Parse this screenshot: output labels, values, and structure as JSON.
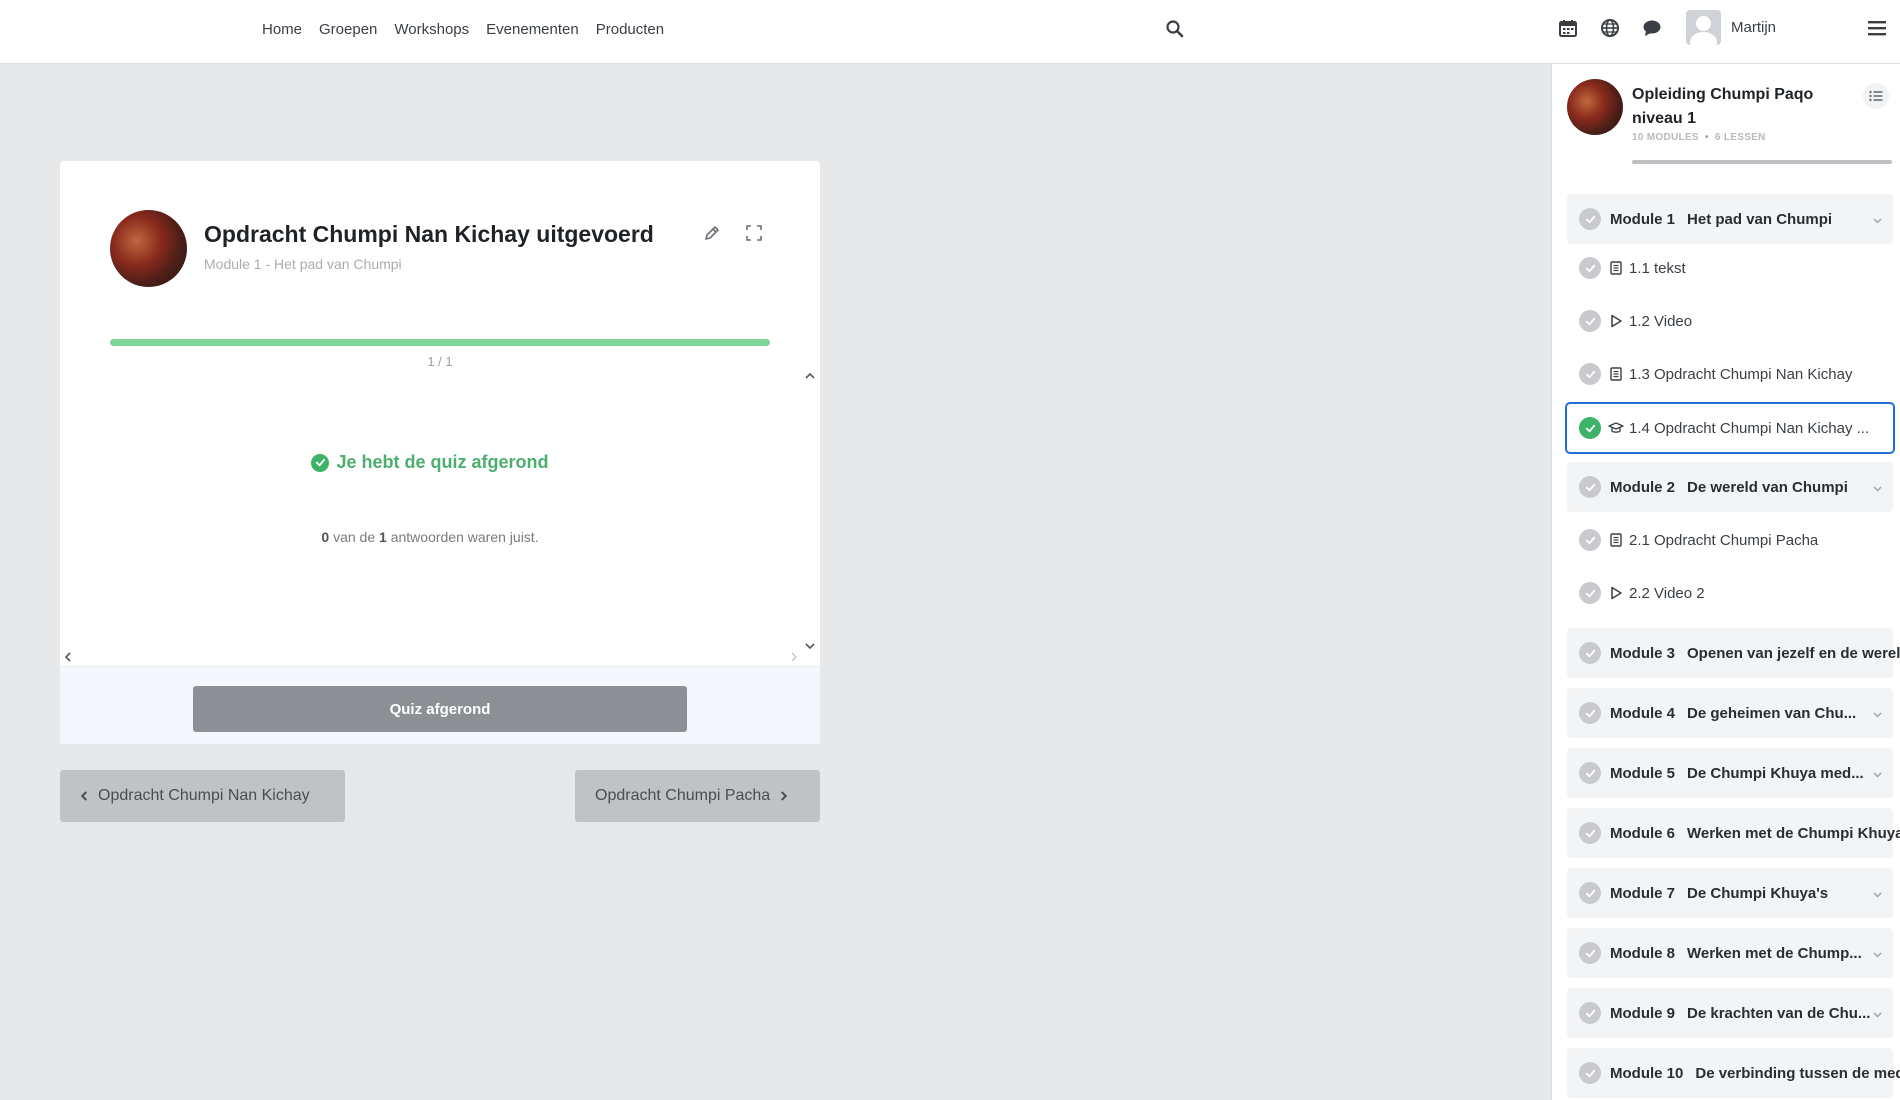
{
  "topnav": {
    "links": [
      "Home",
      "Groepen",
      "Workshops",
      "Evenementen",
      "Producten"
    ],
    "user_name": "Martijn"
  },
  "quiz": {
    "title": "Opdracht Chumpi Nan Kichay uitgevoerd",
    "subtitle": "Module 1 - Het pad van Chumpi",
    "progress_text": "1 / 1",
    "progress_fraction": 1.0,
    "done_message": "Je hebt de quiz afgerond",
    "result_correct": "0",
    "result_mid": "van de",
    "result_total": "1",
    "result_suffix": "antwoorden waren juist.",
    "button_label": "Quiz afgerond",
    "prev_label": "Opdracht Chumpi Nan Kichay",
    "next_label": "Opdracht Chumpi Pacha"
  },
  "sidebar": {
    "course_title": "Opleiding Chumpi Paqo niveau 1",
    "modules_count": "10 MODULES",
    "lessons_count": "6 LESSEN",
    "items": [
      {
        "kind": "module",
        "num": "Module 1",
        "name": "Het pad van Chumpi",
        "chevron": true
      },
      {
        "kind": "lesson",
        "icon": "doc",
        "name": "1.1 tekst"
      },
      {
        "kind": "lesson",
        "icon": "play",
        "name": "1.2 Video"
      },
      {
        "kind": "lesson",
        "icon": "doc",
        "name": "1.3 Opdracht Chumpi Nan Kichay"
      },
      {
        "kind": "lesson",
        "icon": "quiz",
        "name": "1.4 Opdracht Chumpi Nan Kichay ...",
        "active": true
      },
      {
        "kind": "module",
        "num": "Module 2",
        "name": "De wereld van Chumpi",
        "chevron": true
      },
      {
        "kind": "lesson",
        "icon": "doc",
        "name": "2.1 Opdracht Chumpi Pacha"
      },
      {
        "kind": "lesson",
        "icon": "play",
        "name": "2.2 Video 2"
      },
      {
        "kind": "module",
        "num": "Module 3",
        "name": "Openen van jezelf en de wereld",
        "chevron": false
      },
      {
        "kind": "module",
        "num": "Module 4",
        "name": "De geheimen van Chu...",
        "chevron": true
      },
      {
        "kind": "module",
        "num": "Module 5",
        "name": "De Chumpi Khuya med...",
        "chevron": true
      },
      {
        "kind": "module",
        "num": "Module 6",
        "name": "Werken met de Chumpi Khuya's",
        "chevron": false
      },
      {
        "kind": "module",
        "num": "Module 7",
        "name": "De Chumpi Khuya's",
        "chevron": true
      },
      {
        "kind": "module",
        "num": "Module 8",
        "name": "Werken met de Chump...",
        "chevron": true
      },
      {
        "kind": "module",
        "num": "Module 9",
        "name": "De krachten van de Chu...",
        "chevron": true
      },
      {
        "kind": "module",
        "num": "Module 10",
        "name": "De verbinding tussen de mede",
        "chevron": false
      }
    ]
  },
  "colors": {
    "progress_green": "#7ed59a",
    "success_green": "#4caf6e",
    "active_blue": "#1e6fd9"
  }
}
